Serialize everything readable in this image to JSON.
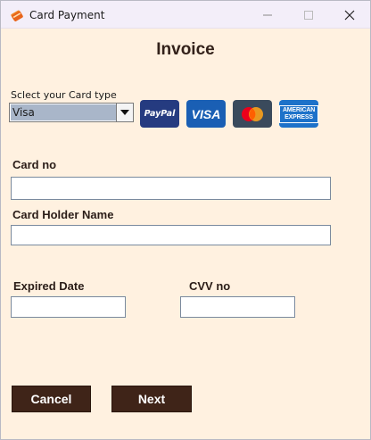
{
  "window": {
    "title": "Card Payment",
    "icon": "credit-card-icon"
  },
  "heading": "Invoice",
  "card_type": {
    "label": "Sclect your Card type",
    "selected": "Visa",
    "logos": [
      {
        "name": "PayPal",
        "text": "PayPal",
        "color": "#253b80"
      },
      {
        "name": "Visa",
        "text": "VISA",
        "color": "#1a5fb4"
      },
      {
        "name": "Mastercard",
        "text": "",
        "color": "#3a4a5c"
      },
      {
        "name": "American Express",
        "text": "AMERICAN EXPRESS",
        "color": "#1d72c9"
      }
    ]
  },
  "fields": {
    "card_no_label": "Card no",
    "card_no_value": "",
    "holder_label": "Card Holder Name",
    "holder_value": "",
    "expiry_label": "Expired Date",
    "expiry_value": "",
    "cvv_label": "CVV no",
    "cvv_value": ""
  },
  "buttons": {
    "cancel": "Cancel",
    "next": "Next"
  },
  "colors": {
    "background": "#fff1e0",
    "button": "#3f2418",
    "heading": "#33211a"
  }
}
